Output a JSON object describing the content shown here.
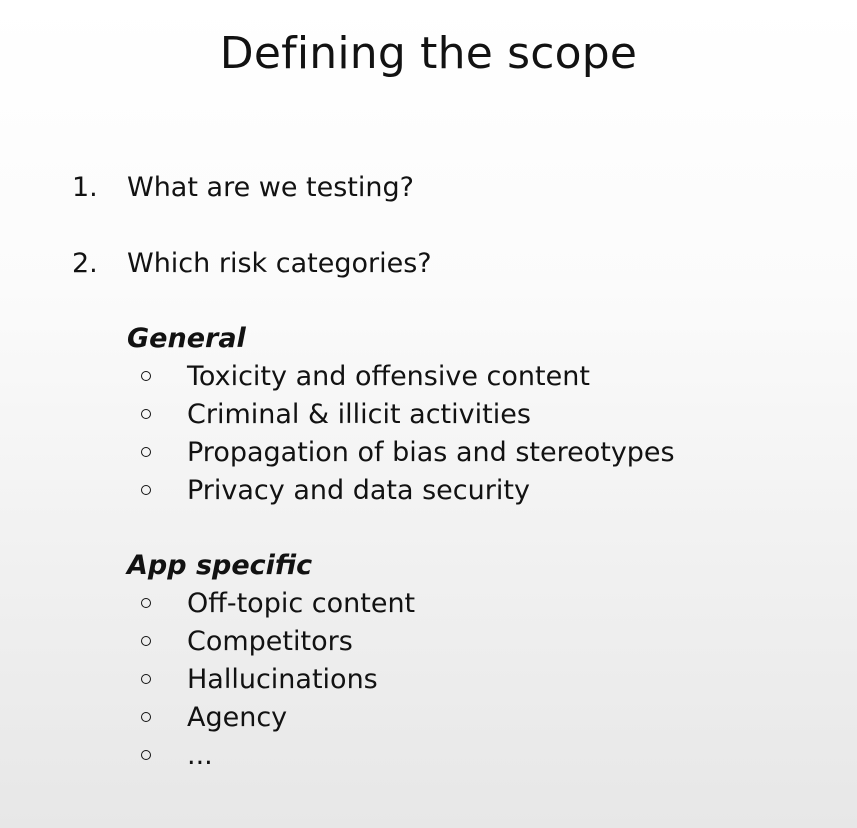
{
  "slide": {
    "title": "Defining the scope",
    "questions": [
      {
        "number": "1.",
        "text": "What are we testing?"
      },
      {
        "number": "2.",
        "text": "Which risk categories?"
      }
    ],
    "general": {
      "heading": "General",
      "items": [
        "Toxicity and offensive content",
        "Criminal & illicit activities",
        "Propagation of bias and stereotypes",
        "Privacy and data security"
      ]
    },
    "app_specific": {
      "heading": "App specific",
      "items": [
        "Off-topic content",
        "Competitors",
        "Hallucinations",
        "Agency",
        "..."
      ]
    }
  }
}
